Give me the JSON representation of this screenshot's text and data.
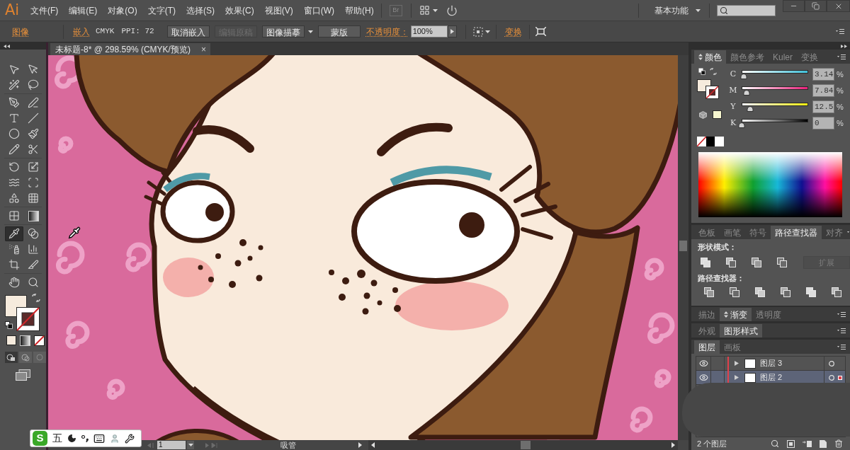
{
  "app": {
    "logo": "Ai",
    "menu": [
      "文件(F)",
      "编辑(E)",
      "对象(O)",
      "文字(T)",
      "选择(S)",
      "效果(C)",
      "视图(V)",
      "窗口(W)",
      "帮助(H)"
    ],
    "bridge": "Br",
    "workspace": "基本功能"
  },
  "control_bar": {
    "object_type": "图像",
    "embed": "嵌入",
    "color_mode": "CMYK",
    "ppi": "PPI: 72",
    "buttons": [
      {
        "label": "取消嵌入",
        "disabled": false,
        "kind": "plain"
      },
      {
        "label": "编辑原稿",
        "disabled": true,
        "kind": "plain"
      },
      {
        "label": "图像描摹",
        "disabled": false,
        "kind": "dropdown"
      },
      {
        "label": "蒙版",
        "disabled": false,
        "kind": "plain"
      }
    ],
    "opacity": {
      "label": "不透明度：",
      "value": "100%"
    },
    "transform": "变换"
  },
  "document": {
    "title": "未标题-8* @ 298.59% (CMYK/预览)",
    "close": "×"
  },
  "tools": [
    [
      {
        "kind": "selection",
        "selected": false
      },
      {
        "kind": "direct",
        "selected": false
      }
    ],
    [
      {
        "kind": "wand",
        "selected": false
      },
      {
        "kind": "lasso",
        "selected": false
      }
    ],
    [
      {
        "kind": "pen",
        "selected": false
      },
      {
        "kind": "curvature",
        "selected": false
      }
    ],
    [
      {
        "kind": "type",
        "selected": false
      },
      {
        "kind": "line",
        "selected": false
      }
    ],
    [
      {
        "kind": "ellipse",
        "selected": false
      },
      {
        "kind": "brush",
        "selected": false
      }
    ],
    [
      {
        "kind": "pencil",
        "selected": false
      },
      {
        "kind": "scissors",
        "selected": false
      }
    ],
    [
      {
        "kind": "rotate",
        "selected": false
      },
      {
        "kind": "scale",
        "selected": false
      }
    ],
    [
      {
        "kind": "warp",
        "selected": false
      },
      {
        "kind": "transform",
        "selected": false
      }
    ],
    [
      {
        "kind": "builder",
        "selected": false
      },
      {
        "kind": "perspective",
        "selected": false
      }
    ],
    [
      {
        "kind": "mesh",
        "selected": false
      },
      {
        "kind": "gradient",
        "selected": false
      }
    ],
    [
      {
        "kind": "eyedropper",
        "selected": true
      },
      {
        "kind": "blend",
        "selected": false
      }
    ],
    [
      {
        "kind": "sprayer",
        "selected": false
      },
      {
        "kind": "graph",
        "selected": false
      }
    ],
    [
      {
        "kind": "artboard",
        "selected": false
      },
      {
        "kind": "slice",
        "selected": false
      }
    ],
    [
      {
        "kind": "hand",
        "selected": false
      },
      {
        "kind": "zoom",
        "selected": false
      }
    ]
  ],
  "color_panel": {
    "tabs": [
      {
        "label": "颜色",
        "selected": true,
        "toggle": true
      },
      {
        "label": "颜色参考",
        "selected": false,
        "toggle": false
      },
      {
        "label": "Kuler",
        "selected": false,
        "toggle": false
      },
      {
        "label": "变换",
        "selected": false,
        "toggle": false
      }
    ],
    "sliders": [
      {
        "name": "C",
        "value": "3.14",
        "unit": "%",
        "level": 0.03
      },
      {
        "name": "M",
        "value": "7.84",
        "unit": "%",
        "level": 0.07
      },
      {
        "name": "Y",
        "value": "12.5",
        "unit": "%",
        "level": 0.13
      },
      {
        "name": "K",
        "value": "0",
        "unit": "%",
        "level": 0
      }
    ]
  },
  "pathfinder_panel": {
    "tabs": [
      {
        "label": "色板",
        "selected": false,
        "toggle": false
      },
      {
        "label": "画笔",
        "selected": false,
        "toggle": false
      },
      {
        "label": "符号",
        "selected": false,
        "toggle": false
      },
      {
        "label": "路径查找器",
        "selected": true,
        "toggle": false
      },
      {
        "label": "对齐",
        "selected": false,
        "toggle": false
      }
    ],
    "shape_modes": "形状模式：",
    "expand": {
      "label": "扩展",
      "disabled": true
    },
    "pathfinders": "路径查找器："
  },
  "stroke_group": {
    "tabs": [
      {
        "label": "描边",
        "selected": false,
        "toggle": false
      },
      {
        "label": "渐变",
        "selected": true,
        "toggle": true
      },
      {
        "label": "透明度",
        "selected": false,
        "toggle": false
      }
    ]
  },
  "style_group": {
    "tabs": [
      {
        "label": "外观",
        "selected": false,
        "toggle": false
      },
      {
        "label": "图形样式",
        "selected": true,
        "toggle": false
      }
    ]
  },
  "layers_panel": {
    "tabs": [
      {
        "label": "图层",
        "selected": true,
        "toggle": false
      },
      {
        "label": "画板",
        "selected": false,
        "toggle": false
      }
    ],
    "layers": [
      {
        "name": "图层 3",
        "visible": true,
        "expanded": false,
        "selected": false
      },
      {
        "name": "图层 2",
        "visible": true,
        "expanded": false,
        "selected": true
      }
    ],
    "count": "2 个图层"
  },
  "status_bar": {
    "page": "1",
    "tool": "吸管"
  },
  "ime": {
    "logo": "S",
    "mode": "五"
  }
}
